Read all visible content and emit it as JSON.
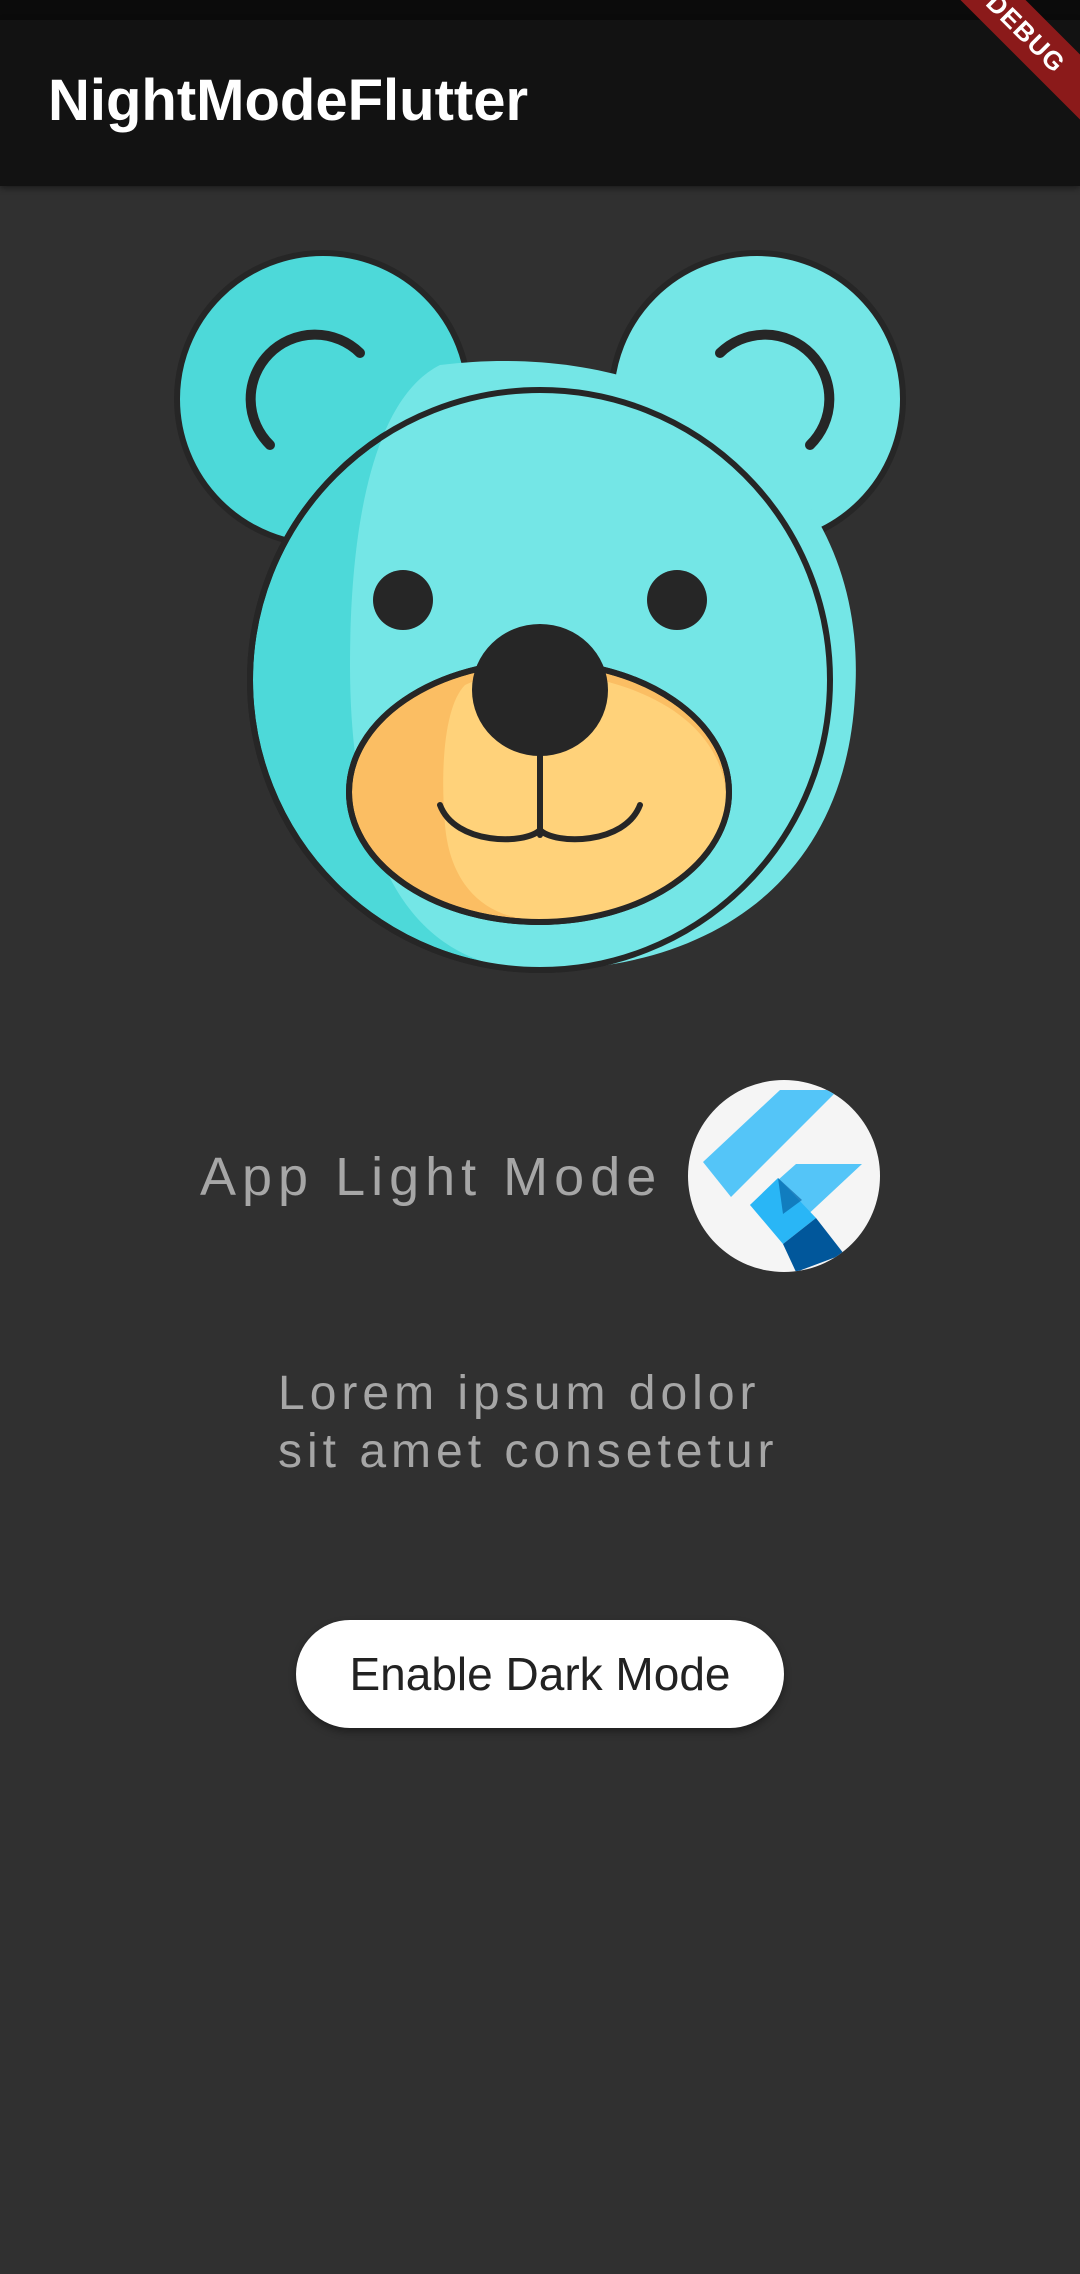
{
  "app_bar": {
    "title": "NightModeFlutter"
  },
  "debug_banner": {
    "label": "DEBUG"
  },
  "hero": {
    "icon": "teddy-bear-icon",
    "colors": {
      "head": "#74E6E6",
      "head_shade": "#4DD9D9",
      "muzzle": "#FFD27A",
      "muzzle_shade": "#FBBE63",
      "outline": "#262626"
    }
  },
  "mode_section": {
    "label": "App Light Mode",
    "logo_icon": "flutter-logo-icon"
  },
  "description": {
    "line1": "Lorem ipsum dolor",
    "line2": "sit amet consetetur"
  },
  "toggle_button": {
    "label": "Enable Dark Mode"
  },
  "theme": {
    "background": "#303030",
    "app_bar": "#121212",
    "text_muted": "#A6A6A6",
    "button_bg": "#FFFFFF",
    "debug_banner": "#8B1A1A"
  }
}
